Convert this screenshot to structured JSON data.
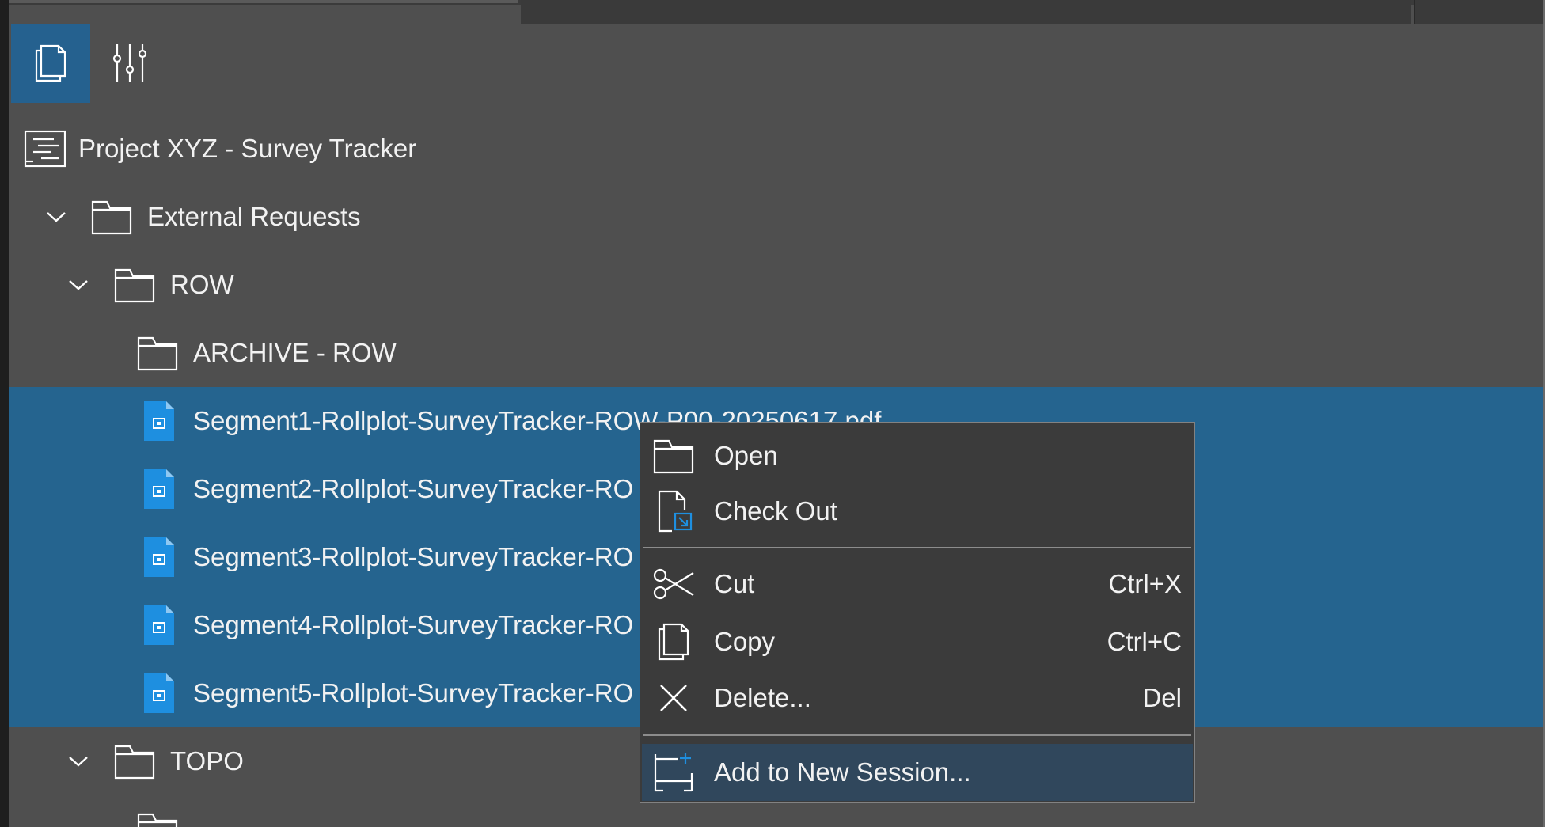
{
  "toolbar": {
    "files_icon": "documents-icon",
    "settings_icon": "sliders-icon"
  },
  "tree": {
    "project": {
      "label": "Project XYZ - Survey Tracker",
      "icon": "project-icon"
    },
    "external_requests": {
      "label": "External Requests",
      "icon": "folder-icon"
    },
    "row_folder": {
      "label": "ROW",
      "icon": "folder-icon"
    },
    "archive_row": {
      "label": "ARCHIVE - ROW",
      "icon": "folder-icon"
    },
    "files": [
      {
        "label": "Segment1-Rollplot-SurveyTracker-ROW-P00-20250617.pdf"
      },
      {
        "label": "Segment2-Rollplot-SurveyTracker-RO"
      },
      {
        "label": "Segment3-Rollplot-SurveyTracker-RO"
      },
      {
        "label": "Segment4-Rollplot-SurveyTracker-RO"
      },
      {
        "label": "Segment5-Rollplot-SurveyTracker-RO"
      }
    ],
    "topo": {
      "label": "TOPO",
      "icon": "folder-icon"
    }
  },
  "context_menu": {
    "open": "Open",
    "check_out": "Check Out",
    "cut": "Cut",
    "cut_shortcut": "Ctrl+X",
    "copy": "Copy",
    "copy_shortcut": "Ctrl+C",
    "delete": "Delete...",
    "delete_shortcut": "Del",
    "add_session": "Add to New Session..."
  },
  "colors": {
    "background": "#4f4f4f",
    "selection": "#25648f",
    "accent": "#1e8fe0",
    "menu_bg": "#3b3b3b",
    "menu_highlight": "#30475c"
  }
}
